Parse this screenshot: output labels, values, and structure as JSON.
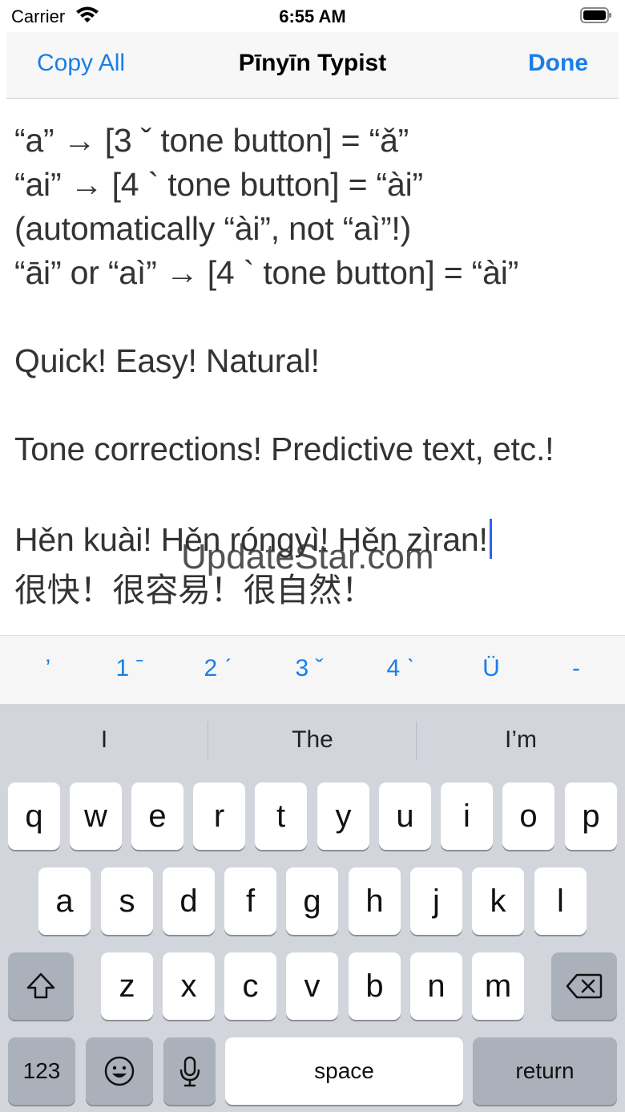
{
  "status_bar": {
    "carrier": "Carrier",
    "time": "6:55 AM"
  },
  "nav_bar": {
    "left_button": "Copy All",
    "title": "Pīnyīn Typist",
    "right_button": "Done"
  },
  "editor": {
    "lines": [
      "“a” → [3 ˇ tone button] = “ǎ”",
      "“ai” → [4 ` tone button] = “ài”",
      "(automatically “ài”, not “aì”!)",
      "“āi” or “aì” → [4 ` tone button] = “ài”",
      "",
      "Quick! Easy! Natural!",
      "",
      "Tone corrections! Predictive text, etc.!",
      "",
      "Hěn kuài! Hěn róngyì! Hěn zìran!",
      "很快！很容易！很自然！"
    ]
  },
  "watermark": "UpdateStar.com",
  "tone_bar": {
    "keys": [
      "’",
      "1 ˉ",
      "2 ˊ",
      "3 ˇ",
      "4 ˋ",
      "Ü",
      "-"
    ]
  },
  "keyboard": {
    "suggestions": [
      "I",
      "The",
      "I’m"
    ],
    "row1": [
      "q",
      "w",
      "e",
      "r",
      "t",
      "y",
      "u",
      "i",
      "o",
      "p"
    ],
    "row2": [
      "a",
      "s",
      "d",
      "f",
      "g",
      "h",
      "j",
      "k",
      "l"
    ],
    "row3": [
      "z",
      "x",
      "c",
      "v",
      "b",
      "n",
      "m"
    ],
    "numbers_label": "123",
    "space_label": "space",
    "return_label": "return"
  },
  "colors": {
    "accent": "#1a7ee6",
    "keyboard_bg": "#d2d5db",
    "dark_key": "#abb1ba",
    "cursor": "#2f62f1"
  }
}
